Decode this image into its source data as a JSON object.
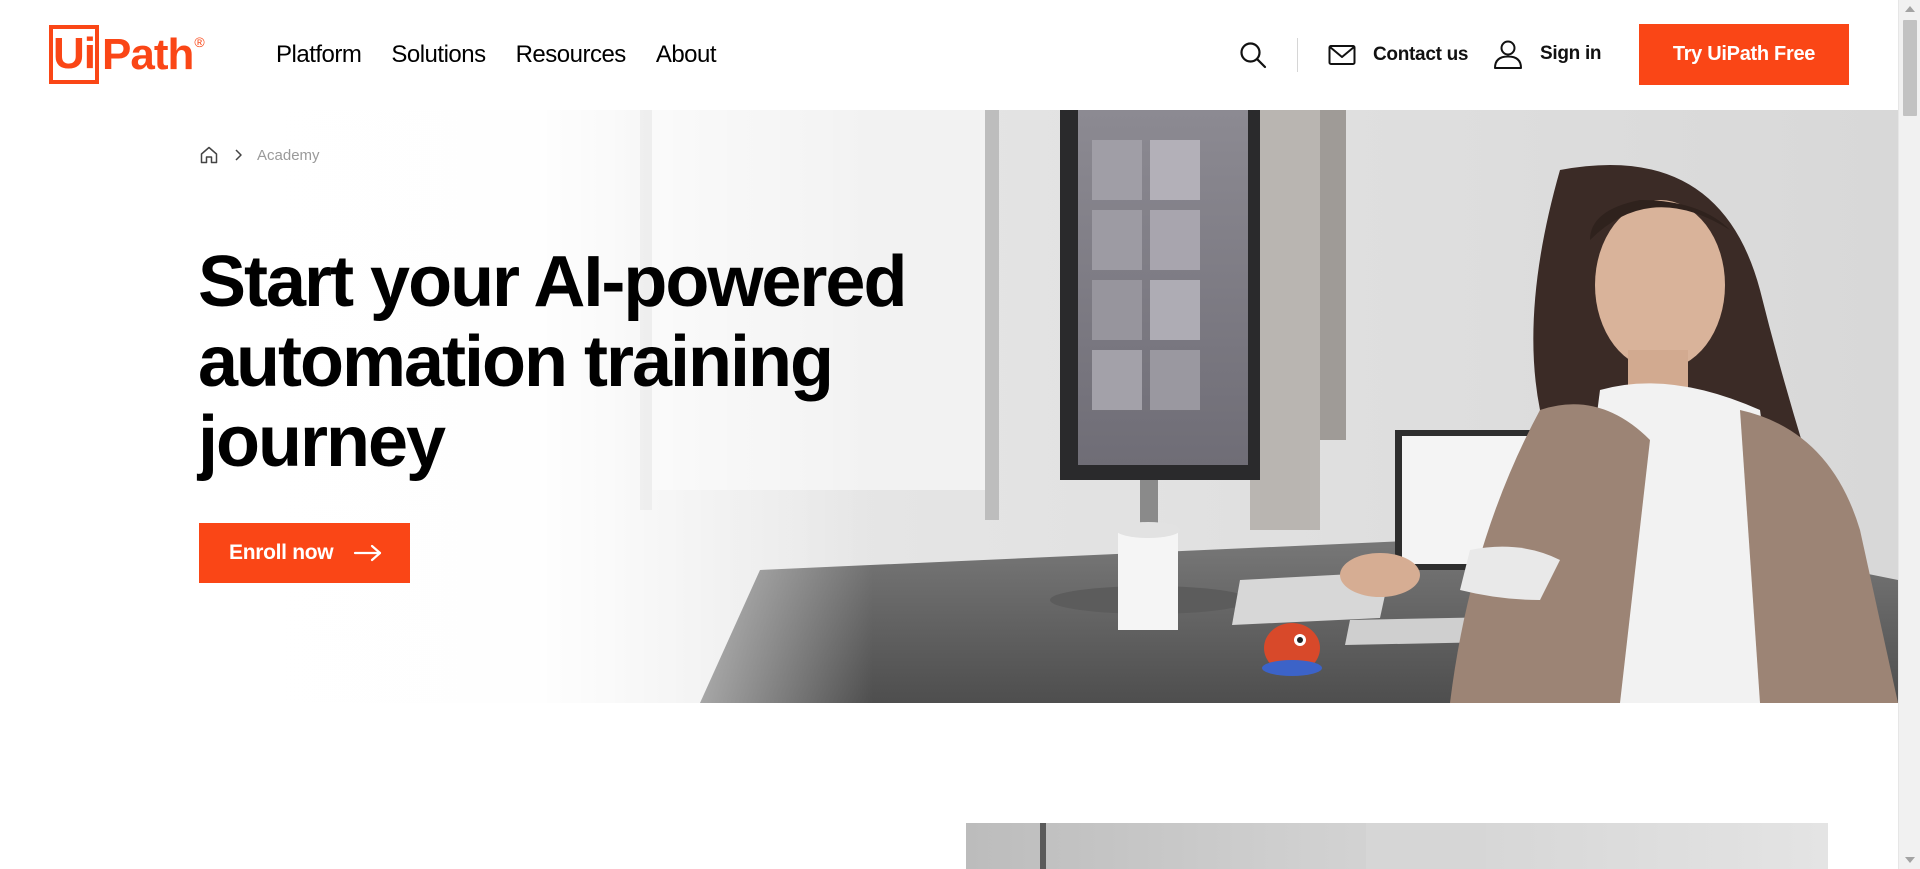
{
  "brand": {
    "logo_box_text": "Ui",
    "logo_rest_text": "Path",
    "logo_registered": "®",
    "accent_color": "#fa4616"
  },
  "nav": {
    "items": [
      {
        "label": "Platform"
      },
      {
        "label": "Solutions"
      },
      {
        "label": "Resources"
      },
      {
        "label": "About"
      }
    ]
  },
  "header_actions": {
    "search_icon": "search-icon",
    "contact_label": "Contact us",
    "contact_icon": "mail-icon",
    "signin_label": "Sign in",
    "signin_icon": "user-icon",
    "cta_label": "Try UiPath Free"
  },
  "breadcrumb": {
    "home_icon": "home-icon",
    "separator_icon": "chevron-right-icon",
    "current": "Academy"
  },
  "hero": {
    "headline": "Start your AI-powered automation training journey",
    "enroll_label": "Enroll now",
    "enroll_icon": "arrow-right-icon"
  }
}
